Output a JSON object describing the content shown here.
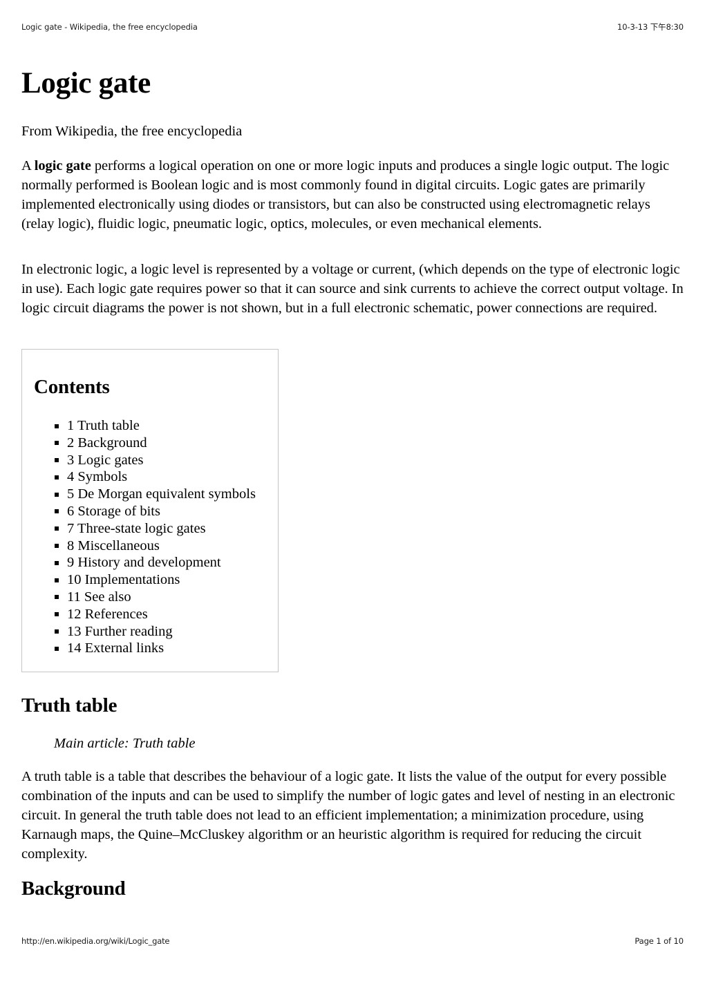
{
  "header": {
    "left": "Logic gate - Wikipedia, the free encyclopedia",
    "right": "10-3-13 下午8:30"
  },
  "footer": {
    "url": "http://en.wikipedia.org/wiki/Logic_gate",
    "page": "Page 1 of 10"
  },
  "article": {
    "title": "Logic gate",
    "subtitle": "From Wikipedia, the free encyclopedia",
    "intro_lead": "A ",
    "intro_bold": "logic gate",
    "intro_rest": " performs a logical operation on one or more logic inputs and produces a single logic output. The logic normally performed is Boolean logic and is most commonly found in digital circuits. Logic gates are primarily implemented electronically using diodes or transistors, but can also be constructed using electromagnetic relays (relay logic), fluidic logic, pneumatic logic, optics, molecules, or even mechanical elements.",
    "para2": "In electronic logic, a logic level is represented by a voltage or current, (which depends on the type of electronic logic in use). Each logic gate requires power so that it can source and sink currents to achieve the correct output voltage. In logic circuit diagrams the power is not shown, but in a full electronic schematic, power connections are required."
  },
  "toc": {
    "title": "Contents",
    "items": [
      {
        "label": "1 Truth table"
      },
      {
        "label": "2 Background"
      },
      {
        "label": "3 Logic gates"
      },
      {
        "label": "4 Symbols"
      },
      {
        "label": "5 De Morgan equivalent symbols"
      },
      {
        "label": "6 Storage of bits"
      },
      {
        "label": "7 Three-state logic gates"
      },
      {
        "label": "8 Miscellaneous"
      },
      {
        "label": "9 History and development"
      },
      {
        "label": "10 Implementations"
      },
      {
        "label": "11 See also"
      },
      {
        "label": "12 References"
      },
      {
        "label": "13 Further reading"
      },
      {
        "label": "14 External links"
      }
    ]
  },
  "sections": {
    "truth_table": {
      "heading": "Truth table",
      "main_article": "Main article: Truth table",
      "body": "A truth table is a table that describes the behaviour of a logic gate. It lists the value of the output for every possible combination of the inputs and can be used to simplify the number of logic gates and level of nesting in an electronic circuit. In general the truth table does not lead to an efficient implementation; a minimization procedure, using Karnaugh maps, the Quine–McCluskey algorithm or an heuristic algorithm is required for reducing the circuit complexity."
    },
    "background": {
      "heading": "Background"
    }
  },
  "colors": {
    "text": "#000000",
    "toc_border": "#c5c5c5",
    "page_background": "#ffffff"
  }
}
